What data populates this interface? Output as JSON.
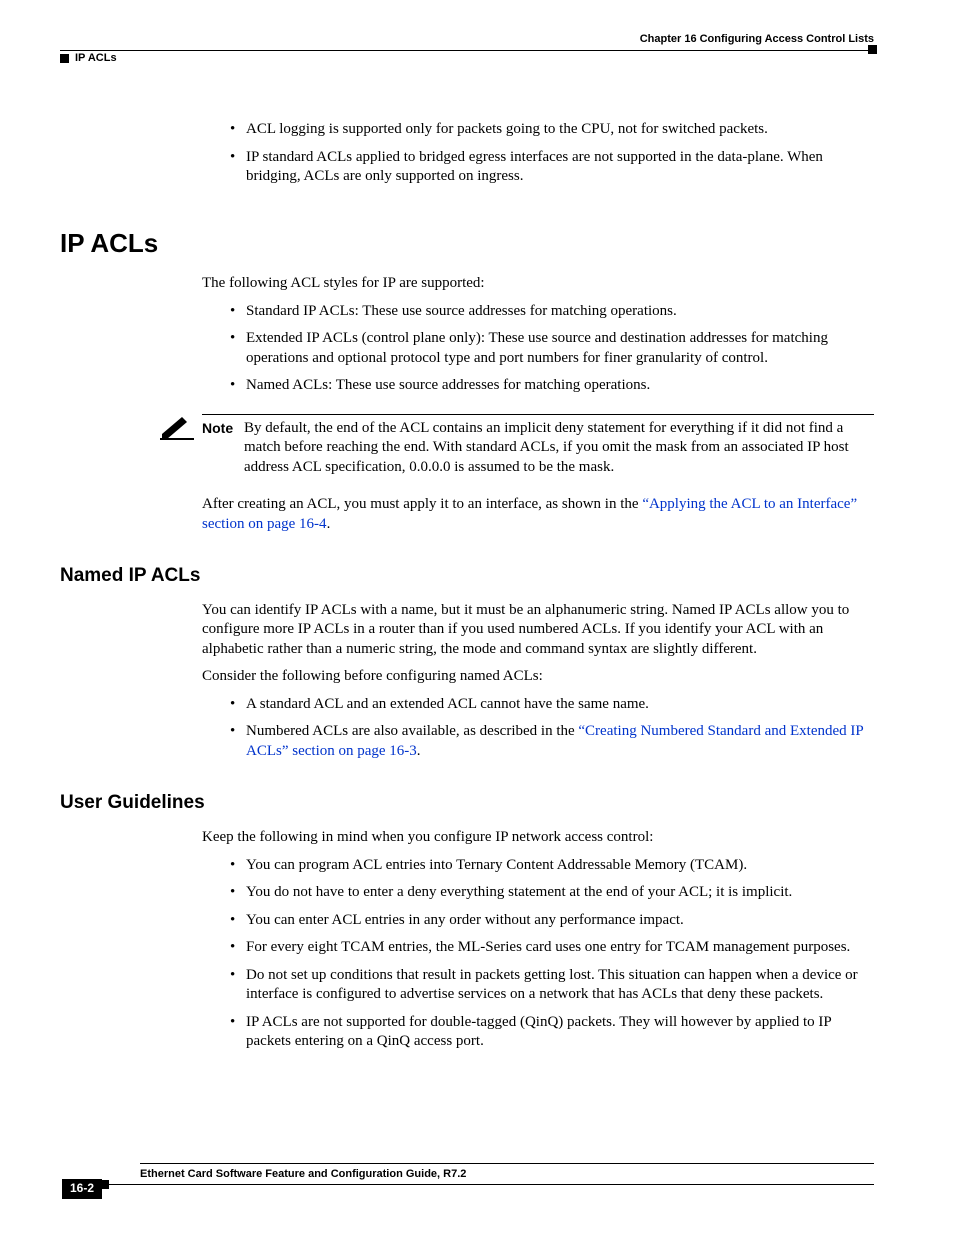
{
  "header": {
    "chapter": "Chapter 16 Configuring Access Control Lists",
    "section": "IP ACLs"
  },
  "intro_bullets": [
    "ACL logging is supported only for packets going to the CPU, not for switched packets.",
    "IP standard ACLs applied to bridged egress interfaces are not supported in the data-plane. When bridging, ACLs are only supported on ingress."
  ],
  "ip_acls": {
    "heading": "IP ACLs",
    "intro": "The following ACL styles for IP are supported:",
    "bullets": [
      "Standard IP ACLs: These use source addresses for matching operations.",
      "Extended IP ACLs (control plane only): These use source and destination addresses for matching operations and optional protocol type and port numbers for finer granularity of control.",
      "Named ACLs: These use source addresses for matching operations."
    ],
    "note_label": "Note",
    "note_text": "By default, the end of the ACL contains an implicit deny statement for everything if it did not find a match before reaching the end. With standard ACLs, if you omit the mask from an associated IP host address ACL specification, 0.0.0.0 is assumed to be the mask.",
    "after_note_pre": "After creating an ACL, you must apply it to an interface, as shown in the ",
    "after_note_link": "“Applying the ACL to an Interface” section on page 16-4",
    "after_note_post": "."
  },
  "named": {
    "heading": "Named IP ACLs",
    "para1": "You can identify IP ACLs with a name, but it must be an alphanumeric string. Named IP ACLs allow you to configure more IP ACLs in a router than if you used numbered ACLs. If you identify your ACL with an alphabetic rather than a numeric string, the mode and command syntax are slightly different.",
    "para2": "Consider the following before configuring named ACLs:",
    "bullet1": "A standard ACL and an extended ACL cannot have the same name.",
    "bullet2_pre": "Numbered ACLs are also available, as described in the ",
    "bullet2_link": "“Creating Numbered Standard and Extended IP ACLs” section on page 16-3",
    "bullet2_post": "."
  },
  "guidelines": {
    "heading": "User Guidelines",
    "intro": "Keep the following in mind when you configure IP network access control:",
    "bullets": [
      "You can program ACL entries into Ternary Content Addressable Memory (TCAM).",
      "You do not have to enter a deny everything statement at the end of your ACL; it is implicit.",
      "You can enter ACL entries in any order without any performance impact.",
      "For every eight TCAM entries, the ML-Series card uses one entry for TCAM management purposes.",
      "Do not set up conditions that result in packets getting lost. This situation can happen when a device or interface is configured to advertise services on a network that has ACLs that deny these packets.",
      "IP ACLs are not supported for double-tagged (QinQ) packets. They will however by applied to IP packets entering on a QinQ access port."
    ]
  },
  "footer": {
    "title": "Ethernet Card Software Feature and Configuration Guide, R7.2",
    "page": "16-2"
  }
}
